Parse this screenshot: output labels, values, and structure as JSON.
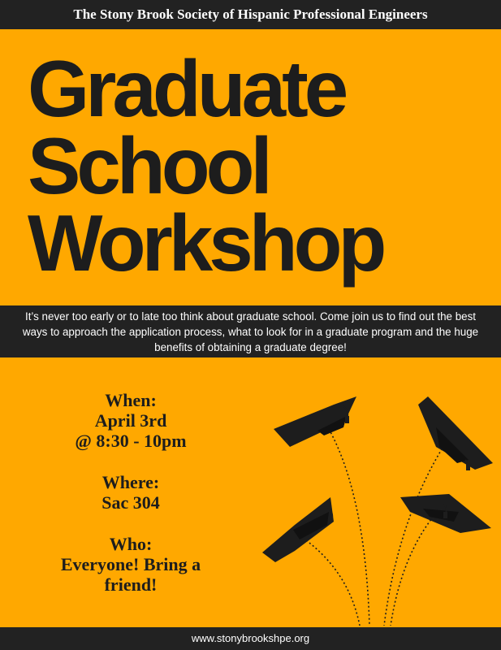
{
  "colors": {
    "background": "#ffa800",
    "bar": "#222222",
    "text_dark": "#1d1d1d",
    "text_light": "#ffffff"
  },
  "header": {
    "organization": "The Stony Brook Society of Hispanic Professional Engineers"
  },
  "title": {
    "lines": [
      "Graduate",
      "School",
      "Workshop"
    ]
  },
  "description": "It’s never too early or to late too think about graduate school. Come join us to find out the best ways to approach the application process, what to look for in a graduate program and the huge benefits of obtaining a graduate degree!",
  "details": {
    "when": {
      "label": "When:",
      "lines": [
        "April 3rd",
        "@ 8:30 - 10pm"
      ]
    },
    "where": {
      "label": "Where:",
      "lines": [
        "Sac 304"
      ]
    },
    "who": {
      "label": "Who:",
      "lines": [
        "Everyone! Bring a",
        "friend!"
      ]
    }
  },
  "graphic": {
    "icon": "graduation-cap-icon",
    "count": 4
  },
  "footer": {
    "url": "www.stonybrookshpe.org"
  }
}
